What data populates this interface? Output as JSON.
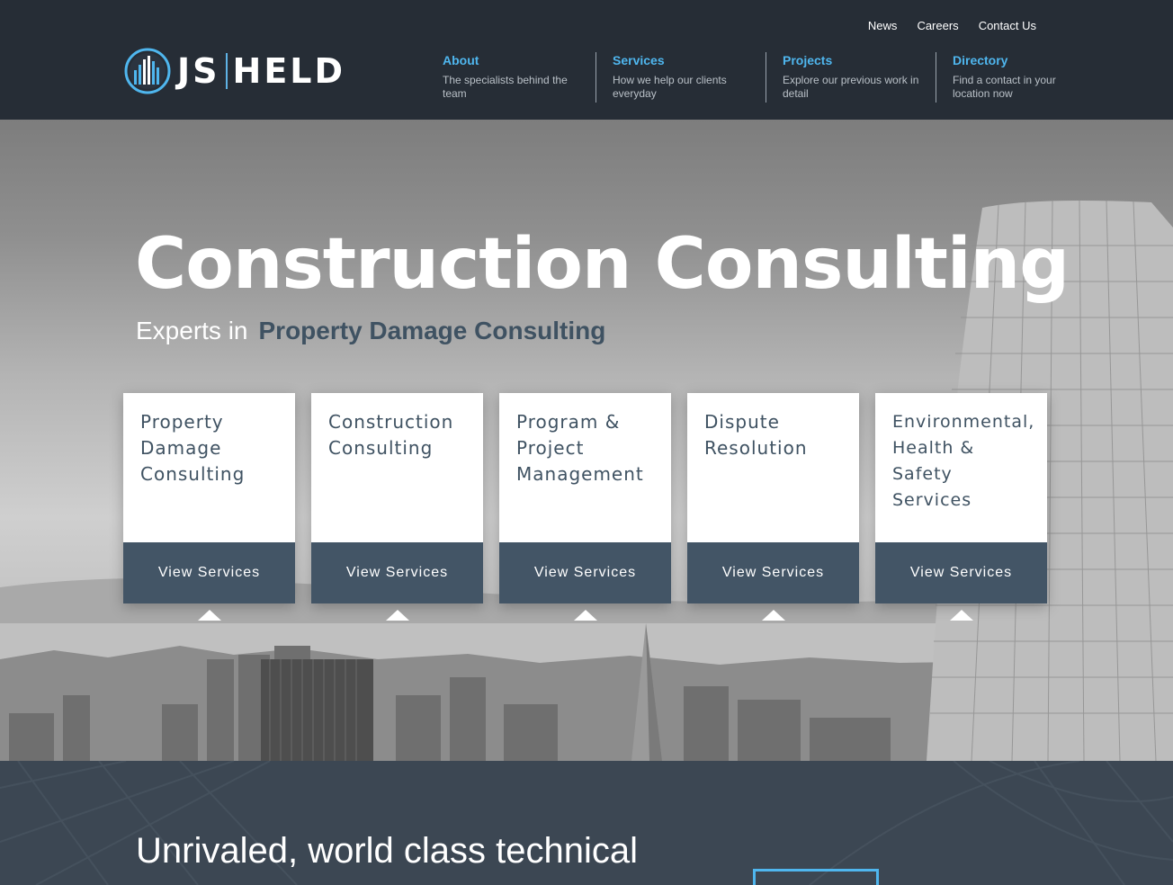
{
  "brand": {
    "name_left": "JS",
    "name_right": "HELD"
  },
  "utility_nav": [
    "News",
    "Careers",
    "Contact Us"
  ],
  "main_nav": [
    {
      "title": "About",
      "desc": "The specialists behind the team"
    },
    {
      "title": "Services",
      "desc": "How we help our clients everyday"
    },
    {
      "title": "Projects",
      "desc": "Explore our previous work in detail"
    },
    {
      "title": "Directory",
      "desc": "Find a contact in your location now"
    }
  ],
  "hero": {
    "title": "Construction Consulting",
    "sub_prefix": "Experts in",
    "sub_highlight": "Property Damage Consulting"
  },
  "cards": [
    {
      "title": "Property Damage Consulting",
      "button": "View Services"
    },
    {
      "title": "Construction Consulting",
      "button": "View Services"
    },
    {
      "title": "Program & Project Management",
      "button": "View Services"
    },
    {
      "title": "Dispute Resolution",
      "button": "View Services"
    },
    {
      "title": "Environmental, Health & Safety Services",
      "button": "View Services"
    }
  ],
  "lower": {
    "title": "Unrivaled, world class technical"
  },
  "colors": {
    "accent": "#4fb6ee",
    "header_bg": "#262d36",
    "card_button": "#435566",
    "highlight_text": "#3f5262"
  }
}
